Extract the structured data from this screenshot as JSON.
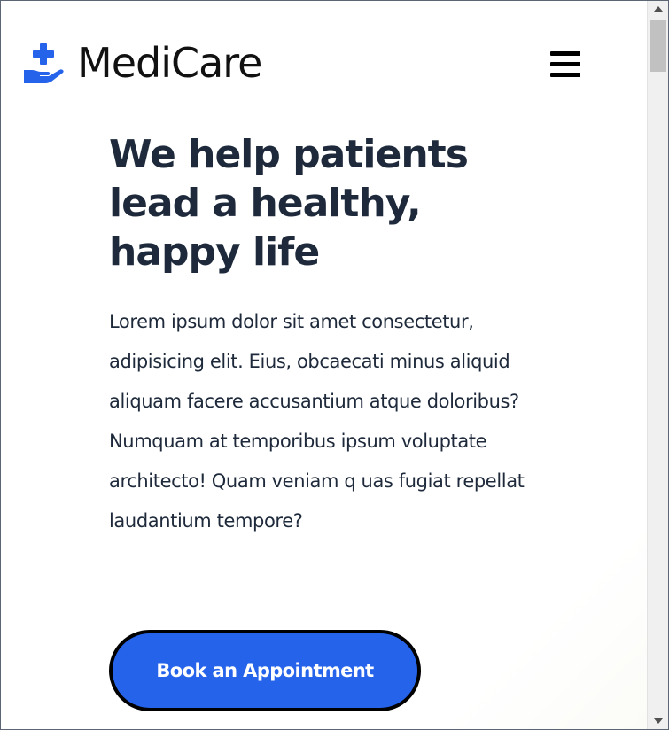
{
  "header": {
    "brand": "MediCare",
    "logo_icon": "hand-holding-medical-icon",
    "menu_icon": "hamburger-menu-icon",
    "accent_color": "#2563eb"
  },
  "hero": {
    "title": "We help patients lead a healthy, happy life",
    "description": "Lorem ipsum dolor sit amet consectetur, adipisicing elit. Eius, obcaecati minus aliquid aliquam facere accusantium atque doloribus? Numquam at temporibus ipsum voluptate architecto! Quam veniam q uas fugiat repellat laudantium tempore?",
    "cta_label": "Book an Appointment"
  },
  "scrollbar": {
    "up_icon": "scroll-up-arrow-icon",
    "down_icon": "scroll-down-arrow-icon"
  }
}
